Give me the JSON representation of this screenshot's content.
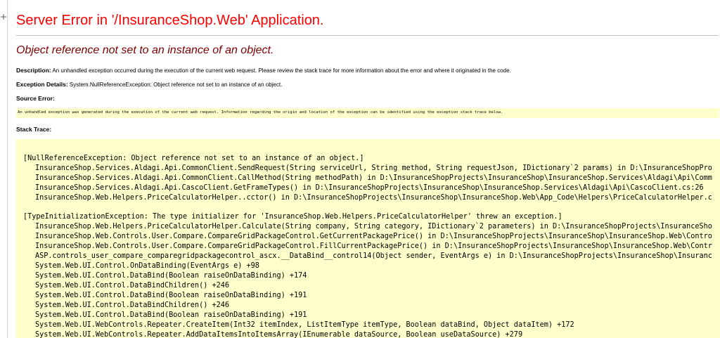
{
  "page": {
    "left_glyph": "+"
  },
  "header": {
    "title": "Server Error in '/InsuranceShop.Web' Application.",
    "error_message": "Object reference not set to an instance of an object."
  },
  "description": {
    "label": "Description:",
    "text": "An unhandled exception occurred during the execution of the current web request. Please review the stack trace for more information about the error and where it originated in the code."
  },
  "exception_details": {
    "label": "Exception Details:",
    "text": "System.NullReferenceException: Object reference not set to an instance of an object."
  },
  "source_error": {
    "heading": "Source Error:",
    "text": "An unhandled exception was generated during the execution of the current web request. Information regarding the origin and location of the exception can be identified using the exception stack trace below."
  },
  "stack_trace": {
    "heading": "Stack Trace:",
    "lines": [
      {
        "kind": "exception",
        "text": "[NullReferenceException: Object reference not set to an instance of an object.]"
      },
      {
        "kind": "frame",
        "text": "InsuranceShop.Services.Aldagi.Api.CommonClient.SendRequest(String serviceUrl, String method, String requestJson, IDictionary`2 params) in D:\\InsuranceShopPro"
      },
      {
        "kind": "frame",
        "text": "InsuranceShop.Services.Aldagi.Api.CommonClient.CallMethod(String methodPath) in D:\\InsuranceShopProjects\\InsuranceShop\\InsuranceShop.Services\\Aldagi\\Api\\Comm"
      },
      {
        "kind": "frame",
        "text": "InsuranceShop.Services.Aldagi.Api.CascoClient.GetFrameTypes() in D:\\InsuranceShopProjects\\InsuranceShop\\InsuranceShop.Services\\Aldagi\\Api\\CascoClient.cs:26"
      },
      {
        "kind": "frame",
        "text": "InsuranceShop.Web.Helpers.PriceCalculatorHelper..cctor() in D:\\InsuranceShopProjects\\InsuranceShop\\InsuranceShop.Web\\App_Code\\Helpers\\PriceCalculatorHelper.c"
      },
      {
        "kind": "exception",
        "text": "[TypeInitializationException: The type initializer for 'InsuranceShop.Web.Helpers.PriceCalculatorHelper' threw an exception.]"
      },
      {
        "kind": "frame",
        "text": "InsuranceShop.Web.Helpers.PriceCalculatorHelper.Calculate(String company, String category, IDictionary`2 parameters) in D:\\InsuranceShopProjects\\InsuranceSho"
      },
      {
        "kind": "frame",
        "text": "InsuranceShop.Web.Controls.User.Compare.CompareGridPackageControl.GetCurrentPackagePrice() in D:\\InsuranceShopProjects\\InsuranceShop\\InsuranceShop.Web\\Contro"
      },
      {
        "kind": "frame",
        "text": "InsuranceShop.Web.Controls.User.Compare.CompareGridPackageControl.FillCurrentPackagePrice() in D:\\InsuranceShopProjects\\InsuranceShop\\InsuranceShop.Web\\Contr"
      },
      {
        "kind": "frame",
        "text": "ASP.controls_user_compare_comparegridpackagecontrol_ascx.__DataBind__control14(Object sender, EventArgs e) in D:\\InsuranceShopProjects\\InsuranceShop\\Insuranc"
      },
      {
        "kind": "frame",
        "text": "System.Web.UI.Control.OnDataBinding(EventArgs e) +98"
      },
      {
        "kind": "frame",
        "text": "System.Web.UI.Control.DataBind(Boolean raiseOnDataBinding) +174"
      },
      {
        "kind": "frame",
        "text": "System.Web.UI.Control.DataBindChildren() +246"
      },
      {
        "kind": "frame",
        "text": "System.Web.UI.Control.DataBind(Boolean raiseOnDataBinding) +191"
      },
      {
        "kind": "frame",
        "text": "System.Web.UI.Control.DataBindChildren() +246"
      },
      {
        "kind": "frame",
        "text": "System.Web.UI.Control.DataBind(Boolean raiseOnDataBinding) +191"
      },
      {
        "kind": "frame",
        "text": "System.Web.UI.WebControls.Repeater.CreateItem(Int32 itemIndex, ListItemType itemType, Boolean dataBind, Object dataItem) +172"
      },
      {
        "kind": "frame",
        "text": "System.Web.UI.WebControls.Repeater.AddDataItemsIntoItemsArray(IEnumerable dataSource, Boolean useDataSource) +279"
      }
    ]
  },
  "colors": {
    "title": "#ff0000",
    "error_message": "#800000",
    "code_background": "#ffffcc"
  }
}
